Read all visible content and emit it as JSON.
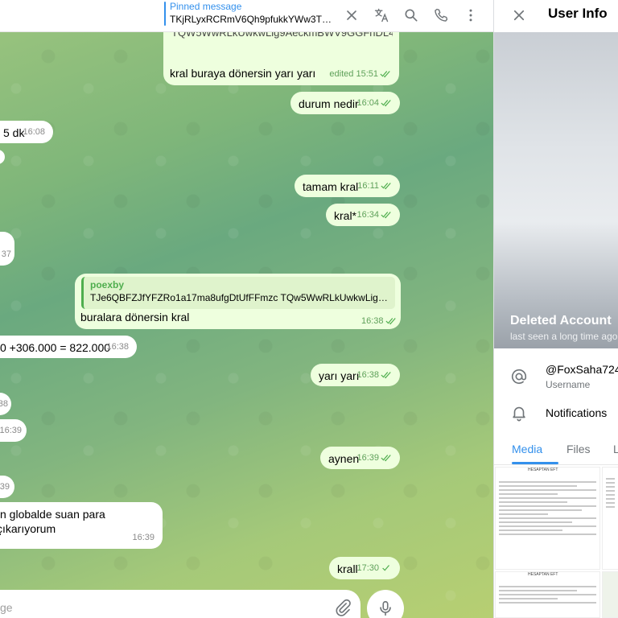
{
  "topbar": {
    "pinned_title": "Pinned message",
    "pinned_text": "TKjRLyxRCRmV6Qh9pfukkYWw3TPk..."
  },
  "messages": {
    "m1_partial": "TQW5WwRLkUwkwLig9AeckmBWV9GGFnDL4t",
    "m1_text": "kral buraya dönersin yarı yarı",
    "m1_edited": "edited",
    "m1_time": "15:51",
    "m2_text": "durum nedir",
    "m2_time": "16:04",
    "m3_text": "5 dk",
    "m3_time": "16:08",
    "m4_text": "tamam kral",
    "m4_time": "16:11",
    "m5_text": "kral*",
    "m5_time": "16:34",
    "m6_time": "37",
    "m7_reply_name": "poexby",
    "m7_reply_text": "TJe6QBFZJfYFZRo1a17ma8ufgDtUfFFmzc TQw5WwRLkUwkwLig9Ae...",
    "m7_text": "buralara dönersin kral",
    "m7_time": "16:38",
    "m8_text": "0 +306.000 = 822.000",
    "m8_time": "16:38",
    "m9_text": "yarı yarı",
    "m9_time": "16:38",
    "m10_time": "38",
    "m11_time": "16:39",
    "m12_text": "aynen",
    "m12_time": "16:39",
    "m13_time": "39",
    "m14_text": "n globalde suan para çıkarıyorum",
    "m14_time": "16:39",
    "m15_text": "krall",
    "m15_time": "17:30"
  },
  "composer": {
    "placeholder": "ge"
  },
  "panel": {
    "title": "User Info",
    "name": "Deleted Account",
    "status": "last seen a long time ago",
    "username": "@FoxSaha724",
    "username_label": "Username",
    "notifications": "Notifications",
    "tabs": [
      "Media",
      "Files",
      "L"
    ]
  },
  "media_docs": {
    "doc1_title": "HESAPTAN EFT",
    "doc2_title": "HESAPTAN EFT"
  },
  "colors": {
    "accent": "#3390ec",
    "out_bubble": "#eeffde",
    "in_bubble": "#ffffff",
    "check_green": "#4fae4e"
  }
}
